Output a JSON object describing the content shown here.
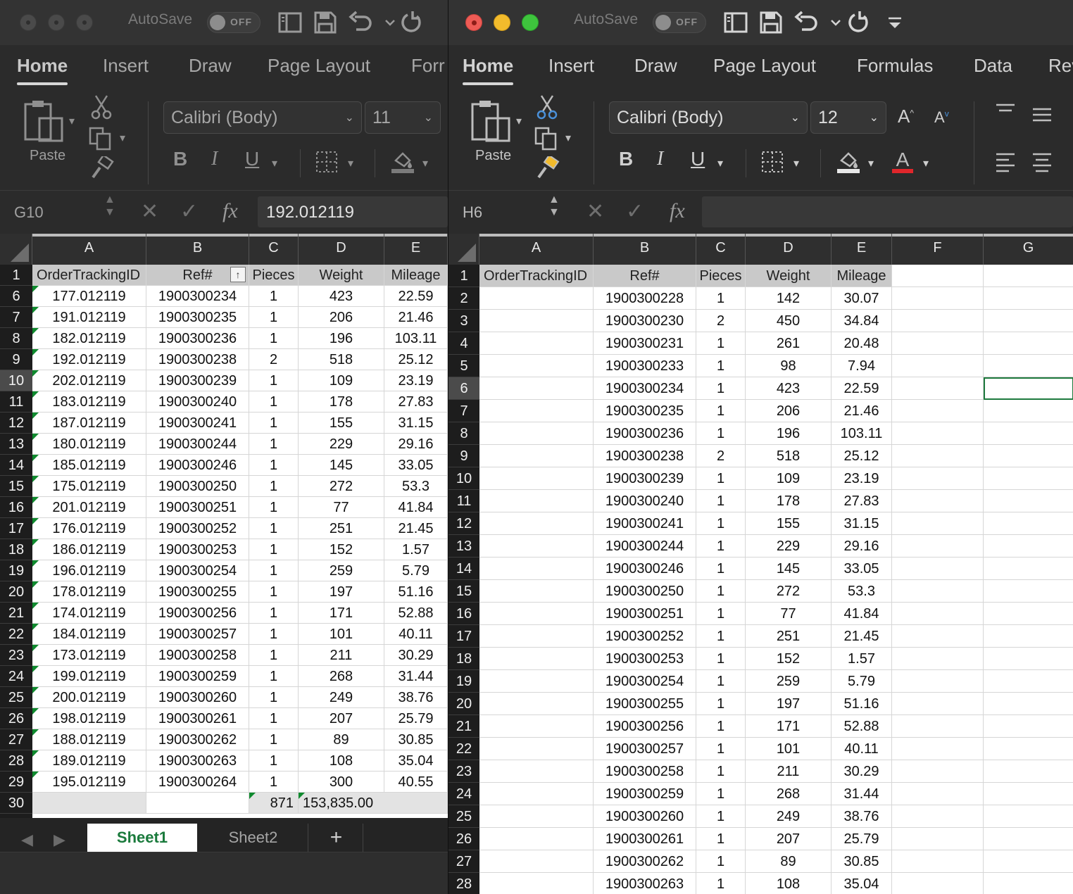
{
  "left_window": {
    "autosave_label": "AutoSave",
    "autosave_state": "OFF",
    "tabs": [
      "Home",
      "Insert",
      "Draw",
      "Page Layout",
      "Forr"
    ],
    "font_name": "Calibri (Body)",
    "font_size": "11",
    "paste_label": "Paste",
    "bold": "B",
    "italic": "I",
    "underline": "U",
    "name_box": "G10",
    "formula_value": "192.012119",
    "columns": [
      "A",
      "B",
      "C",
      "D",
      "E"
    ],
    "headers": [
      "OrderTrackingID",
      "Ref#",
      "Pieces",
      "Weight",
      "Mileage"
    ],
    "rows": [
      {
        "num": "6",
        "cells": [
          "177.012119",
          "1900300234",
          "1",
          "423",
          "22.59"
        ]
      },
      {
        "num": "7",
        "cells": [
          "191.012119",
          "1900300235",
          "1",
          "206",
          "21.46"
        ]
      },
      {
        "num": "8",
        "cells": [
          "182.012119",
          "1900300236",
          "1",
          "196",
          "103.11"
        ]
      },
      {
        "num": "9",
        "cells": [
          "192.012119",
          "1900300238",
          "2",
          "518",
          "25.12"
        ]
      },
      {
        "num": "10",
        "cells": [
          "202.012119",
          "1900300239",
          "1",
          "109",
          "23.19"
        ]
      },
      {
        "num": "11",
        "cells": [
          "183.012119",
          "1900300240",
          "1",
          "178",
          "27.83"
        ]
      },
      {
        "num": "12",
        "cells": [
          "187.012119",
          "1900300241",
          "1",
          "155",
          "31.15"
        ]
      },
      {
        "num": "13",
        "cells": [
          "180.012119",
          "1900300244",
          "1",
          "229",
          "29.16"
        ]
      },
      {
        "num": "14",
        "cells": [
          "185.012119",
          "1900300246",
          "1",
          "145",
          "33.05"
        ]
      },
      {
        "num": "15",
        "cells": [
          "175.012119",
          "1900300250",
          "1",
          "272",
          "53.3"
        ]
      },
      {
        "num": "16",
        "cells": [
          "201.012119",
          "1900300251",
          "1",
          "77",
          "41.84"
        ]
      },
      {
        "num": "17",
        "cells": [
          "176.012119",
          "1900300252",
          "1",
          "251",
          "21.45"
        ]
      },
      {
        "num": "18",
        "cells": [
          "186.012119",
          "1900300253",
          "1",
          "152",
          "1.57"
        ]
      },
      {
        "num": "19",
        "cells": [
          "196.012119",
          "1900300254",
          "1",
          "259",
          "5.79"
        ]
      },
      {
        "num": "20",
        "cells": [
          "178.012119",
          "1900300255",
          "1",
          "197",
          "51.16"
        ]
      },
      {
        "num": "21",
        "cells": [
          "174.012119",
          "1900300256",
          "1",
          "171",
          "52.88"
        ]
      },
      {
        "num": "22",
        "cells": [
          "184.012119",
          "1900300257",
          "1",
          "101",
          "40.11"
        ]
      },
      {
        "num": "23",
        "cells": [
          "173.012119",
          "1900300258",
          "1",
          "211",
          "30.29"
        ]
      },
      {
        "num": "24",
        "cells": [
          "199.012119",
          "1900300259",
          "1",
          "268",
          "31.44"
        ]
      },
      {
        "num": "25",
        "cells": [
          "200.012119",
          "1900300260",
          "1",
          "249",
          "38.76"
        ]
      },
      {
        "num": "26",
        "cells": [
          "198.012119",
          "1900300261",
          "1",
          "207",
          "25.79"
        ]
      },
      {
        "num": "27",
        "cells": [
          "188.012119",
          "1900300262",
          "1",
          "89",
          "30.85"
        ]
      },
      {
        "num": "28",
        "cells": [
          "189.012119",
          "1900300263",
          "1",
          "108",
          "35.04"
        ]
      },
      {
        "num": "29",
        "cells": [
          "195.012119",
          "1900300264",
          "1",
          "300",
          "40.55"
        ]
      }
    ],
    "total_row": {
      "num": "30",
      "pieces": "871",
      "weight": "153,835.00"
    },
    "sheet_tabs": [
      "Sheet1",
      "Sheet2"
    ],
    "add_sheet": "+"
  },
  "right_window": {
    "autosave_label": "AutoSave",
    "autosave_state": "OFF",
    "tabs": [
      "Home",
      "Insert",
      "Draw",
      "Page Layout",
      "Formulas",
      "Data",
      "Rev"
    ],
    "font_name": "Calibri (Body)",
    "font_size": "12",
    "paste_label": "Paste",
    "bold": "B",
    "italic": "I",
    "underline": "U",
    "name_box": "H6",
    "formula_value": "",
    "columns": [
      "A",
      "B",
      "C",
      "D",
      "E",
      "F",
      "G"
    ],
    "headers": [
      "OrderTrackingID",
      "Ref#",
      "Pieces",
      "Weight",
      "Mileage"
    ],
    "rows": [
      {
        "num": "2",
        "cells": [
          "",
          "1900300228",
          "1",
          "142",
          "30.07"
        ]
      },
      {
        "num": "3",
        "cells": [
          "",
          "1900300230",
          "2",
          "450",
          "34.84"
        ]
      },
      {
        "num": "4",
        "cells": [
          "",
          "1900300231",
          "1",
          "261",
          "20.48"
        ]
      },
      {
        "num": "5",
        "cells": [
          "",
          "1900300233",
          "1",
          "98",
          "7.94"
        ]
      },
      {
        "num": "6",
        "cells": [
          "",
          "1900300234",
          "1",
          "423",
          "22.59"
        ]
      },
      {
        "num": "7",
        "cells": [
          "",
          "1900300235",
          "1",
          "206",
          "21.46"
        ]
      },
      {
        "num": "8",
        "cells": [
          "",
          "1900300236",
          "1",
          "196",
          "103.11"
        ]
      },
      {
        "num": "9",
        "cells": [
          "",
          "1900300238",
          "2",
          "518",
          "25.12"
        ]
      },
      {
        "num": "10",
        "cells": [
          "",
          "1900300239",
          "1",
          "109",
          "23.19"
        ]
      },
      {
        "num": "11",
        "cells": [
          "",
          "1900300240",
          "1",
          "178",
          "27.83"
        ]
      },
      {
        "num": "12",
        "cells": [
          "",
          "1900300241",
          "1",
          "155",
          "31.15"
        ]
      },
      {
        "num": "13",
        "cells": [
          "",
          "1900300244",
          "1",
          "229",
          "29.16"
        ]
      },
      {
        "num": "14",
        "cells": [
          "",
          "1900300246",
          "1",
          "145",
          "33.05"
        ]
      },
      {
        "num": "15",
        "cells": [
          "",
          "1900300250",
          "1",
          "272",
          "53.3"
        ]
      },
      {
        "num": "16",
        "cells": [
          "",
          "1900300251",
          "1",
          "77",
          "41.84"
        ]
      },
      {
        "num": "17",
        "cells": [
          "",
          "1900300252",
          "1",
          "251",
          "21.45"
        ]
      },
      {
        "num": "18",
        "cells": [
          "",
          "1900300253",
          "1",
          "152",
          "1.57"
        ]
      },
      {
        "num": "19",
        "cells": [
          "",
          "1900300254",
          "1",
          "259",
          "5.79"
        ]
      },
      {
        "num": "20",
        "cells": [
          "",
          "1900300255",
          "1",
          "197",
          "51.16"
        ]
      },
      {
        "num": "21",
        "cells": [
          "",
          "1900300256",
          "1",
          "171",
          "52.88"
        ]
      },
      {
        "num": "22",
        "cells": [
          "",
          "1900300257",
          "1",
          "101",
          "40.11"
        ]
      },
      {
        "num": "23",
        "cells": [
          "",
          "1900300258",
          "1",
          "211",
          "30.29"
        ]
      },
      {
        "num": "24",
        "cells": [
          "",
          "1900300259",
          "1",
          "268",
          "31.44"
        ]
      },
      {
        "num": "25",
        "cells": [
          "",
          "1900300260",
          "1",
          "249",
          "38.76"
        ]
      },
      {
        "num": "26",
        "cells": [
          "",
          "1900300261",
          "1",
          "207",
          "25.79"
        ]
      },
      {
        "num": "27",
        "cells": [
          "",
          "1900300262",
          "1",
          "89",
          "30.85"
        ]
      },
      {
        "num": "28",
        "cells": [
          "",
          "1900300263",
          "1",
          "108",
          "35.04"
        ]
      }
    ]
  },
  "colors": {
    "green_indicator": "#0f8a2e",
    "sheet_tab_active_text": "#1a7a3c",
    "font_color_underline": "#e0262b",
    "close_button": "#ee5b55",
    "minimize_button": "#f2bb2c",
    "zoom_button": "#3ec43d"
  }
}
